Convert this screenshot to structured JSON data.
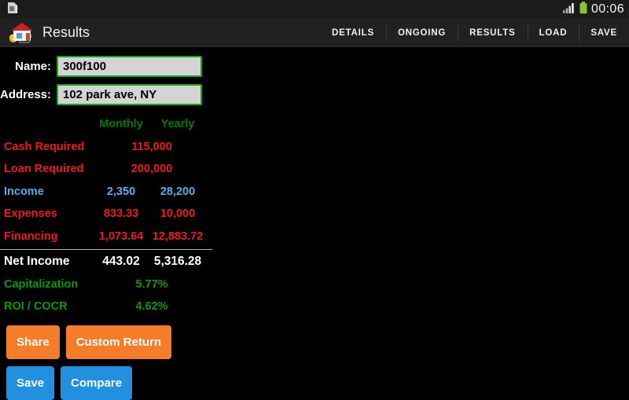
{
  "statusbar": {
    "sim_icon": "sim-card-alert-icon",
    "signal_icon": "signal-bars-icon",
    "battery_icon": "battery-full-icon",
    "time": "00:06"
  },
  "actionbar": {
    "app_icon": "house-with-coins-icon",
    "title": "Results",
    "menu": [
      {
        "label": "DETAILS"
      },
      {
        "label": "ONGOING"
      },
      {
        "label": "RESULTS"
      },
      {
        "label": "LOAD"
      },
      {
        "label": "SAVE"
      }
    ]
  },
  "form": {
    "name_label": "Name:",
    "name_value": "300f100",
    "address_label": "Address:",
    "address_value": "102 park ave, NY"
  },
  "results_table": {
    "headers": {
      "monthly": "Monthly",
      "yearly": "Yearly"
    },
    "rows": [
      {
        "label": "Cash Required",
        "span": "115,000",
        "color": "red"
      },
      {
        "label": "Loan Required",
        "span": "200,000",
        "color": "red"
      },
      {
        "label": "Income",
        "monthly": "2,350",
        "yearly": "28,200",
        "color": "blue"
      },
      {
        "label": "Expenses",
        "monthly": "833.33",
        "yearly": "10,000",
        "color": "red"
      },
      {
        "label": "Financing",
        "monthly": "1,073.64",
        "yearly": "12,883.72",
        "color": "red"
      },
      {
        "label": "Net Income",
        "monthly": "443.02",
        "yearly": "5,316.28",
        "color": "white"
      },
      {
        "label": "Capitalization",
        "span": "5.77%",
        "color": "green"
      },
      {
        "label": "ROI / COCR",
        "span": "4.62%",
        "color": "green"
      }
    ]
  },
  "buttons": {
    "share": "Share",
    "custom_return": "Custom Return",
    "save": "Save",
    "compare": "Compare"
  },
  "colors": {
    "orange": "#f57c28",
    "blue": "#2090df",
    "green_header": "#007a00",
    "green_value": "#0a9a0a",
    "red": "#ed1b1b",
    "income_blue": "#53b0ea",
    "field_border": "#13a513"
  }
}
